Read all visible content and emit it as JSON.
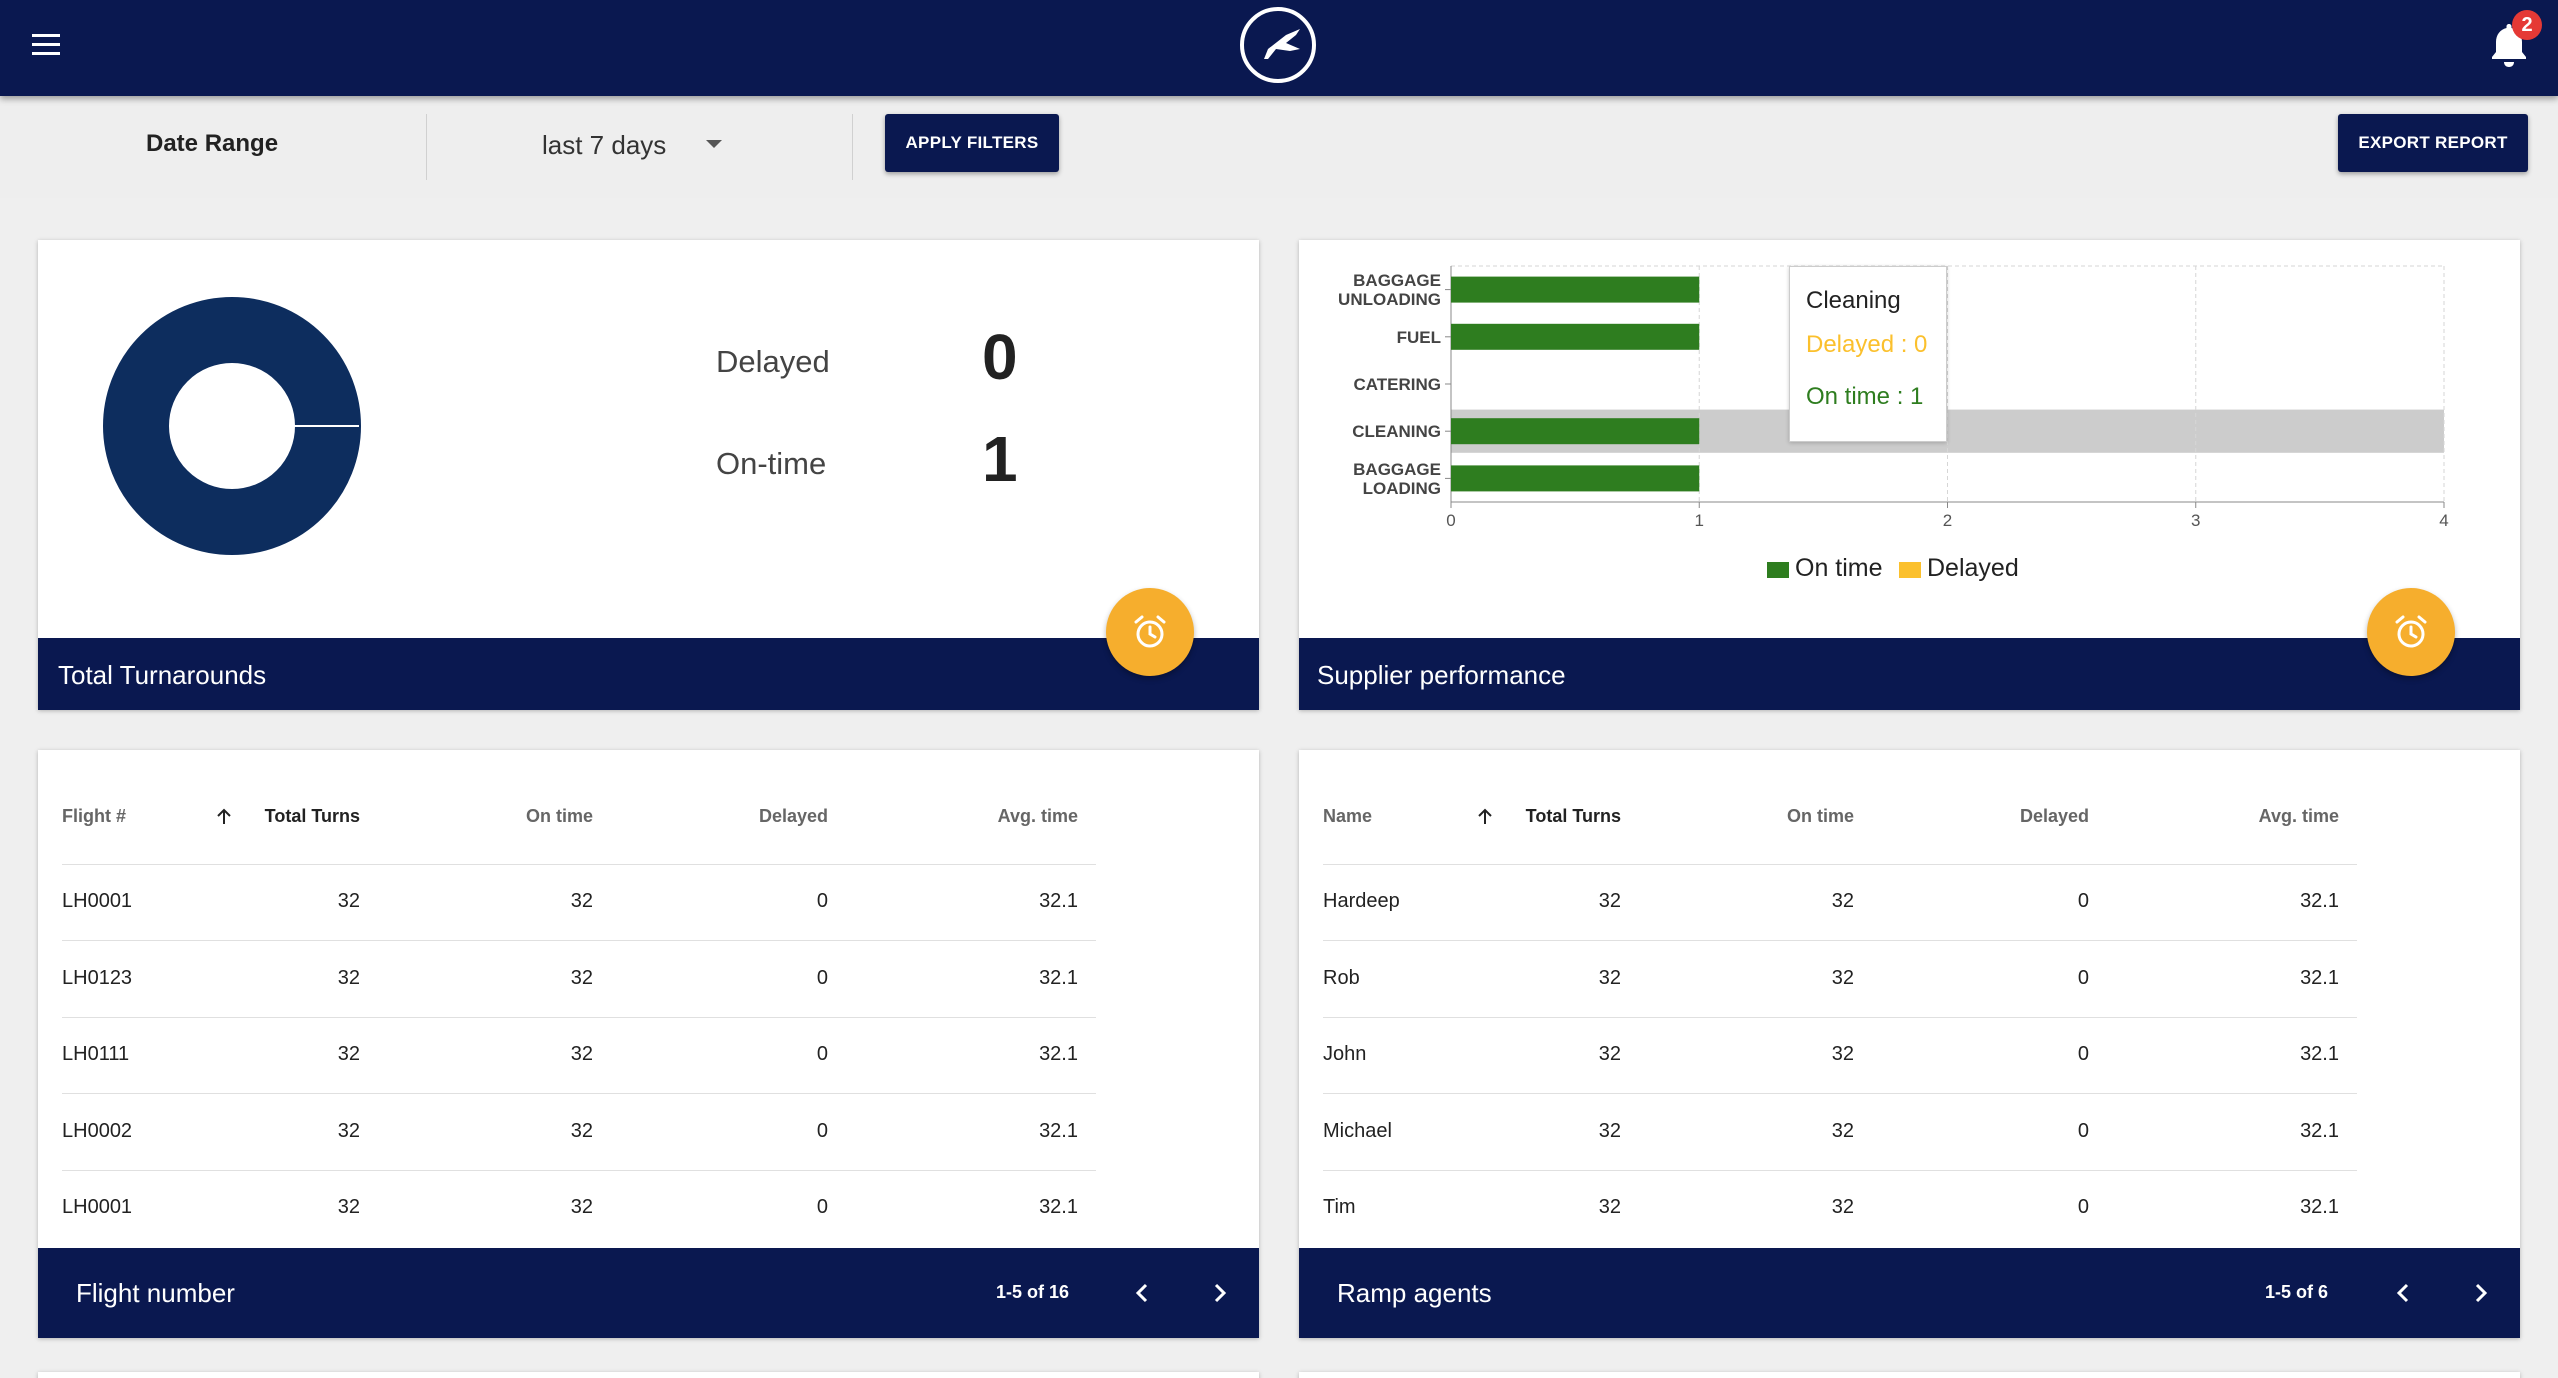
{
  "header": {
    "menu_icon": "hamburger-menu-icon",
    "logo_icon": "crane-logo-icon",
    "notifications": {
      "icon": "bell-icon",
      "count": "2"
    }
  },
  "filters": {
    "date_range_label": "Date Range",
    "date_range_value": "last 7 days",
    "apply_label": "APPLY FILTERS",
    "export_label": "EXPORT REPORT"
  },
  "turnarounds": {
    "title": "Total Turnarounds",
    "delayed_label": "Delayed",
    "delayed_value": "0",
    "ontime_label": "On-time",
    "ontime_value": "1",
    "donut_color": "#0d2d5e"
  },
  "supplier": {
    "title": "Supplier performance",
    "tooltip": {
      "title": "Cleaning",
      "delayed": "Delayed : 0",
      "ontime": "On time : 1"
    },
    "legend": {
      "ontime": "On time",
      "delayed": "Delayed"
    }
  },
  "chart_data": {
    "type": "bar",
    "orientation": "horizontal",
    "categories": [
      "BAGGAGE UNLOADING",
      "FUEL",
      "CATERING",
      "CLEANING",
      "BAGGAGE LOADING"
    ],
    "series": [
      {
        "name": "On time",
        "color": "#2e7d1f",
        "values": [
          1,
          1,
          0,
          1,
          1
        ]
      },
      {
        "name": "Delayed",
        "color": "#fbc02d",
        "values": [
          0,
          0,
          0,
          0,
          0
        ]
      }
    ],
    "xticks": [
      "0",
      "1",
      "2",
      "3",
      "4"
    ],
    "xlim": [
      0,
      4
    ],
    "grid": true,
    "legend_position": "bottom",
    "highlighted_category": "CLEANING"
  },
  "flights": {
    "title": "Flight number",
    "pager_text": "1-5 of 16",
    "headers": [
      "Flight #",
      "Total Turns",
      "On time",
      "Delayed",
      "Avg. time"
    ],
    "rows": [
      [
        "LH0001",
        "32",
        "32",
        "0",
        "32.1"
      ],
      [
        "LH0123",
        "32",
        "32",
        "0",
        "32.1"
      ],
      [
        "LH0111",
        "32",
        "32",
        "0",
        "32.1"
      ],
      [
        "LH0002",
        "32",
        "32",
        "0",
        "32.1"
      ],
      [
        "LH0001",
        "32",
        "32",
        "0",
        "32.1"
      ]
    ]
  },
  "agents": {
    "title": "Ramp agents",
    "pager_text": "1-5 of 6",
    "headers": [
      "Name",
      "Total Turns",
      "On time",
      "Delayed",
      "Avg. time"
    ],
    "rows": [
      [
        "Hardeep",
        "32",
        "32",
        "0",
        "32.1"
      ],
      [
        "Rob",
        "32",
        "32",
        "0",
        "32.1"
      ],
      [
        "John",
        "32",
        "32",
        "0",
        "32.1"
      ],
      [
        "Michael",
        "32",
        "32",
        "0",
        "32.1"
      ],
      [
        "Tim",
        "32",
        "32",
        "0",
        "32.1"
      ]
    ]
  }
}
